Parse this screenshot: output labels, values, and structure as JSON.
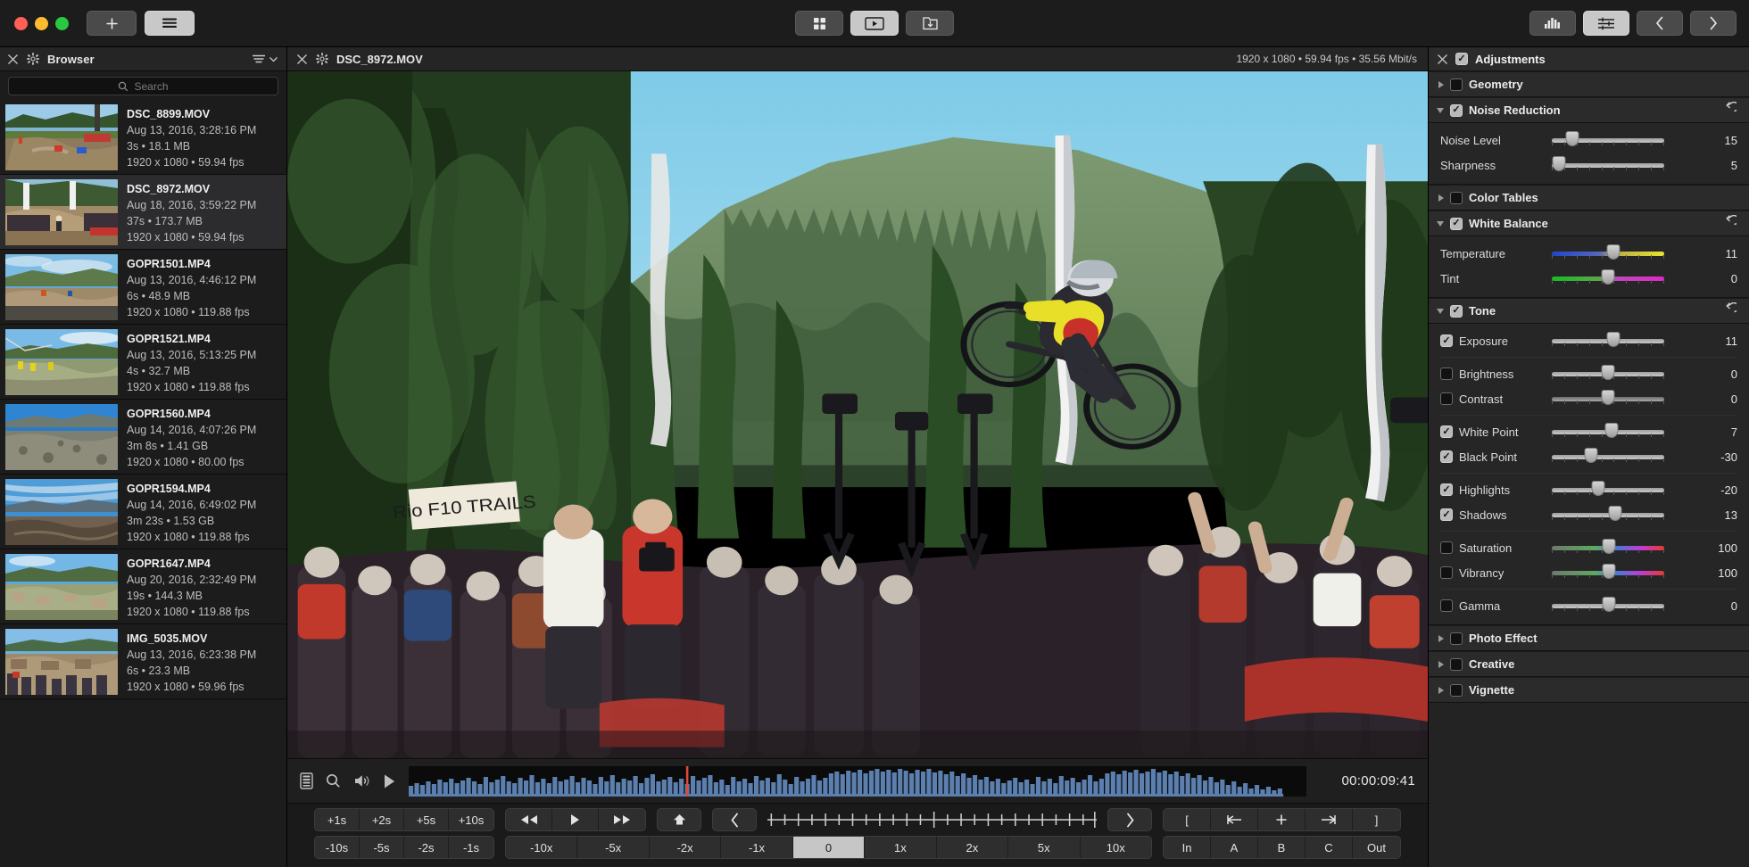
{
  "titlebar": {
    "add_button": "add-new",
    "list_button": "list-view",
    "center_buttons": [
      {
        "name": "grid-view-button",
        "icon": "grid-icon",
        "active": false
      },
      {
        "name": "player-view-button",
        "icon": "play-rect-icon",
        "active": true
      },
      {
        "name": "import-view-button",
        "icon": "import-icon",
        "active": false
      }
    ],
    "right_buttons": [
      {
        "name": "scopes-button",
        "icon": "bar-chart-icon",
        "active": false
      },
      {
        "name": "adjustments-button",
        "icon": "sliders-icon",
        "active": true
      },
      {
        "name": "previous-button",
        "icon": "chevron-left-icon",
        "active": false
      },
      {
        "name": "next-button",
        "icon": "chevron-right-icon",
        "active": false
      }
    ]
  },
  "browser": {
    "title": "Browser",
    "close_icon": "close-icon",
    "gear_icon": "gear-icon",
    "sort_icon": "sort-icon",
    "chevron_icon": "chevron-down-icon",
    "search": {
      "placeholder": "Search",
      "value": "",
      "icon": "search-icon"
    },
    "clips": [
      {
        "name": "DSC_8899.MOV",
        "date": "Aug 13, 2016, 3:28:16 PM",
        "size": "3s • 18.1 MB",
        "format": "1920 x 1080 • 59.94 fps",
        "selected": false,
        "thumb": "bikepark-dirt-jumps"
      },
      {
        "name": "DSC_8972.MOV",
        "date": "Aug 18, 2016, 3:59:22 PM",
        "size": "37s • 173.7 MB",
        "format": "1920 x 1080 • 59.94 fps",
        "selected": true,
        "thumb": "race-course-crowd"
      },
      {
        "name": "GOPR1501.MP4",
        "date": "Aug 13, 2016, 4:46:12 PM",
        "size": "6s • 48.9 MB",
        "format": "1920 x 1080 • 119.88 fps",
        "selected": false,
        "thumb": "mountain-road-sky"
      },
      {
        "name": "GOPR1521.MP4",
        "date": "Aug 13, 2016, 5:13:25 PM",
        "size": "4s • 32.7 MB",
        "format": "1920 x 1080 • 119.88 fps",
        "selected": false,
        "thumb": "ski-lift-trail"
      },
      {
        "name": "GOPR1560.MP4",
        "date": "Aug 14, 2016, 4:07:26 PM",
        "size": "3m 8s • 1.41 GB",
        "format": "1920 x 1080 • 80.00 fps",
        "selected": false,
        "thumb": "alpine-ridge"
      },
      {
        "name": "GOPR1594.MP4",
        "date": "Aug 14, 2016, 6:49:02 PM",
        "size": "3m 23s • 1.53 GB",
        "format": "1920 x 1080 • 119.88 fps",
        "selected": false,
        "thumb": "mountain-vista-clouds"
      },
      {
        "name": "GOPR1647.MP4",
        "date": "Aug 20, 2016, 2:32:49 PM",
        "size": "19s • 144.3 MB",
        "format": "1920 x 1080 • 119.88 fps",
        "selected": false,
        "thumb": "village-hillside"
      },
      {
        "name": "IMG_5035.MOV",
        "date": "Aug 13, 2016, 6:23:38 PM",
        "size": "6s • 23.3 MB",
        "format": "1920 x 1080 • 59.96 fps",
        "selected": false,
        "thumb": "crowd-village-street"
      }
    ]
  },
  "viewer": {
    "close_icon": "close-icon",
    "gear_icon": "gear-icon",
    "title": "DSC_8972.MOV",
    "specs": "1920 x 1080 • 59.94 fps • 35.56 Mbit/s",
    "scrubber": {
      "filmstrip_icon": "filmstrip-icon",
      "zoom_icon": "magnifier-icon",
      "audio_icon": "speaker-icon",
      "play_icon": "play-triangle-icon",
      "timecode": "00:00:09:41",
      "playhead_percent": 31,
      "playhead_color": "#e0483c"
    }
  },
  "transport": {
    "row1": {
      "nudge_forward": [
        "+1s",
        "+2s",
        "+5s",
        "+10s"
      ],
      "playback": [
        {
          "label": "◀◀",
          "name": "rewind-button"
        },
        {
          "label": "▶",
          "name": "play-button"
        },
        {
          "label": "▶▶",
          "name": "fast-forward-button"
        }
      ],
      "home_button": "⌂",
      "step_back_button": "❬",
      "step_forward_button": "❭",
      "mark_buttons": [
        "[",
        "|←",
        "+",
        "→|",
        "]"
      ]
    },
    "row2": {
      "nudge_back": [
        "-10s",
        "-5s",
        "-2s",
        "-1s"
      ],
      "speeds": [
        "-10x",
        "-5x",
        "-2x",
        "-1x",
        "0",
        "1x",
        "2x",
        "5x",
        "10x"
      ],
      "speed_selected": "0",
      "range_buttons": [
        "In",
        "A",
        "B",
        "C",
        "Out"
      ]
    }
  },
  "inspector": {
    "close_icon": "close-icon",
    "title": "Adjustments",
    "enabled": true,
    "reset_icon": "reset-arrow-icon",
    "groups": [
      {
        "name": "Geometry",
        "expanded": false,
        "enabled": false,
        "has_reset": false,
        "params": []
      },
      {
        "name": "Noise Reduction",
        "expanded": true,
        "enabled": true,
        "has_reset": true,
        "params": [
          {
            "label": "Noise Level",
            "value": "15",
            "pos": 18,
            "track": "plain",
            "checkbox": null
          },
          {
            "label": "Sharpness",
            "value": "5",
            "pos": 6,
            "track": "plain",
            "checkbox": null
          }
        ]
      },
      {
        "name": "Color Tables",
        "expanded": false,
        "enabled": false,
        "has_reset": false,
        "params": []
      },
      {
        "name": "White Balance",
        "expanded": true,
        "enabled": true,
        "has_reset": true,
        "params": [
          {
            "label": "Temperature",
            "value": "11",
            "pos": 55,
            "track": "temp",
            "checkbox": null
          },
          {
            "label": "Tint",
            "value": "0",
            "pos": 50,
            "track": "tint",
            "checkbox": null
          }
        ]
      },
      {
        "name": "Tone",
        "expanded": true,
        "enabled": true,
        "has_reset": true,
        "params": [
          {
            "label": "Exposure",
            "value": "11",
            "pos": 55,
            "track": "plain",
            "checkbox": true
          },
          {
            "divider": true
          },
          {
            "label": "Brightness",
            "value": "0",
            "pos": 50,
            "track": "plain",
            "checkbox": false
          },
          {
            "label": "Contrast",
            "value": "0",
            "pos": 50,
            "track": "plain",
            "checkbox": false
          },
          {
            "divider": true
          },
          {
            "label": "White Point",
            "value": "7",
            "pos": 53,
            "track": "plain",
            "checkbox": true
          },
          {
            "label": "Black Point",
            "value": "-30",
            "pos": 35,
            "track": "plain",
            "checkbox": true
          },
          {
            "divider": true
          },
          {
            "label": "Highlights",
            "value": "-20",
            "pos": 41,
            "track": "plain",
            "checkbox": true
          },
          {
            "label": "Shadows",
            "value": "13",
            "pos": 56,
            "track": "plain",
            "checkbox": true
          },
          {
            "divider": true
          },
          {
            "label": "Saturation",
            "value": "100",
            "pos": 51,
            "track": "sat",
            "checkbox": false
          },
          {
            "label": "Vibrancy",
            "value": "100",
            "pos": 51,
            "track": "sat",
            "checkbox": false
          },
          {
            "divider": true
          },
          {
            "label": "Gamma",
            "value": "0",
            "pos": 51,
            "track": "plain",
            "checkbox": false
          }
        ]
      },
      {
        "name": "Photo Effect",
        "expanded": false,
        "enabled": false,
        "has_reset": false,
        "params": []
      },
      {
        "name": "Creative",
        "expanded": false,
        "enabled": false,
        "has_reset": false,
        "params": []
      },
      {
        "name": "Vignette",
        "expanded": false,
        "enabled": false,
        "has_reset": false,
        "params": []
      }
    ]
  }
}
